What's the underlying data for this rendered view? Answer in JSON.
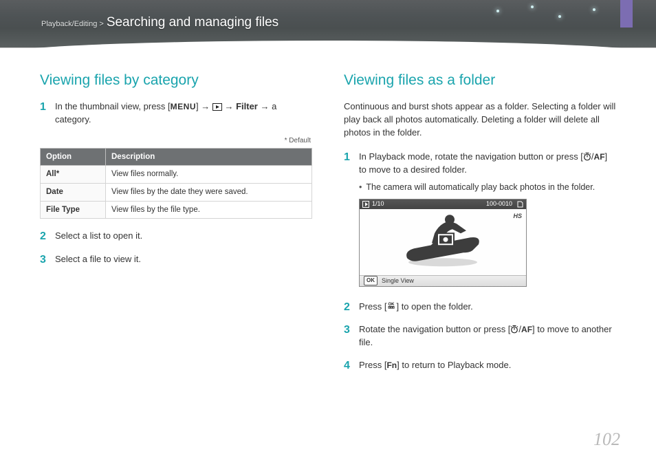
{
  "header": {
    "breadcrumb": "Playback/Editing >",
    "title": "Searching and managing files"
  },
  "left": {
    "heading": "Viewing files by category",
    "step1_a": "In the thumbnail view, press [",
    "step1_menu": "MENU",
    "step1_b": "] → ",
    "step1_c": " → ",
    "step1_filter": "Filter",
    "step1_d": " → a category.",
    "default_note": "* Default",
    "table": {
      "th1": "Option",
      "th2": "Description",
      "rows": [
        {
          "k": "All*",
          "v": "View files normally."
        },
        {
          "k": "Date",
          "v": "View files by the date they were saved."
        },
        {
          "k": "File Type",
          "v": "View files by the file type."
        }
      ]
    },
    "step2": "Select a list to open it.",
    "step3": "Select a file to view it."
  },
  "right": {
    "heading": "Viewing files as a folder",
    "intro": "Continuous and burst shots appear as a folder. Selecting a folder will play back all photos automatically. Deleting a folder will delete all photos in the folder.",
    "step1_a": "In Playback mode, rotate the navigation button or press [",
    "step1_b": "/",
    "step1_c": "] to move to a desired folder.",
    "step1_bullet": "The camera will automatically play back photos in the folder.",
    "lcd": {
      "counter_left": "1/10",
      "counter_right": "100-0010",
      "hs": "HS",
      "ok": "OK",
      "single": "Single View"
    },
    "step2_a": "Press [",
    "step2_b": "] to open the folder.",
    "step3_a": "Rotate the navigation button or press [",
    "step3_b": "/",
    "step3_c": "] to move to another file.",
    "step4_a": "Press [",
    "step4_fn": "Fn",
    "step4_b": "] to return to Playback mode."
  },
  "page_number": "102"
}
